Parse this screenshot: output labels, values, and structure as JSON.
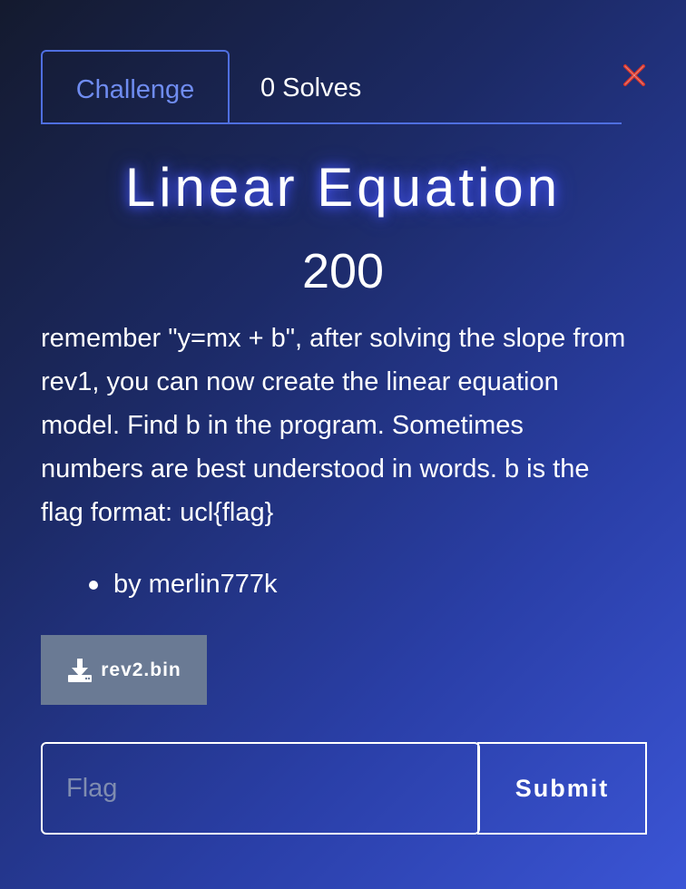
{
  "tabs": [
    {
      "label": "Challenge",
      "active": true
    },
    {
      "label": "0 Solves",
      "active": false
    }
  ],
  "close_icon": "close-x-icon",
  "challenge": {
    "name": "Linear Equation",
    "points": "200",
    "description": "remember \"y=mx + b\", after solving the slope from rev1, you can now create the linear equation model. Find b in the program. Sometimes numbers are best understood in words. b is the flag format: ucl{flag}",
    "authors": [
      "by merlin777k"
    ]
  },
  "file": {
    "name": "rev2.bin",
    "icon": "download-icon"
  },
  "flag_form": {
    "placeholder": "Flag",
    "value": "",
    "submit_label": "Submit"
  },
  "colors": {
    "accent": "#4f6fe0",
    "close": "#d9362b",
    "file_button": "#6a7a94"
  }
}
